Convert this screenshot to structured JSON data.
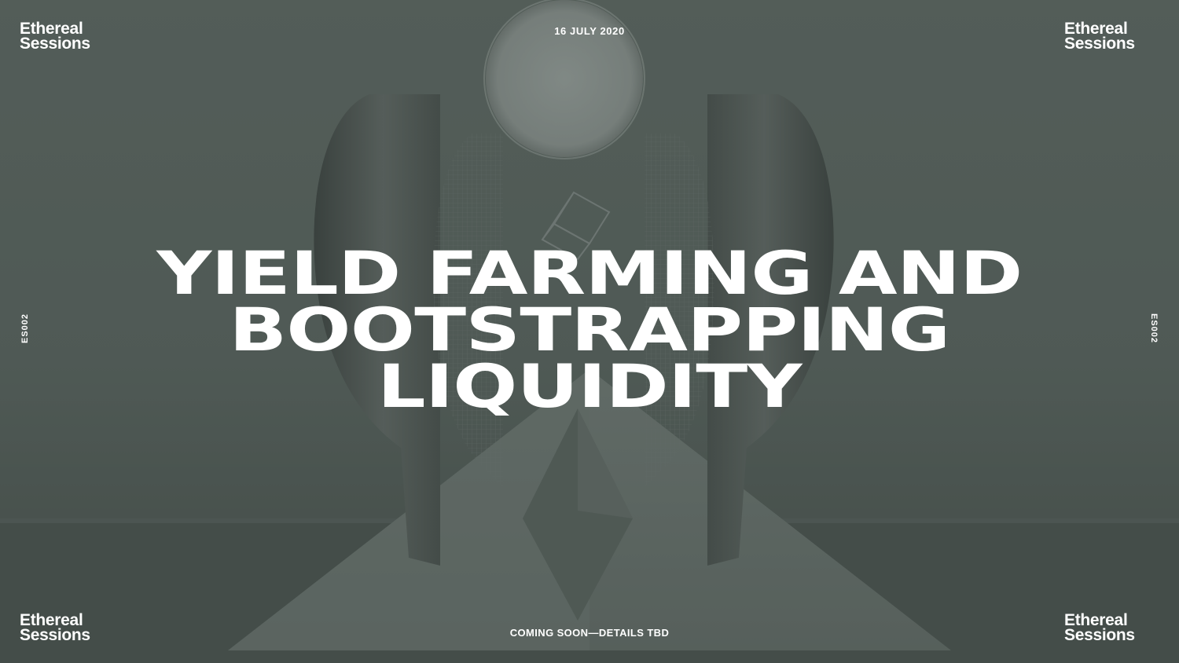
{
  "brand": {
    "line1": "Ethereal",
    "line2": "Sessions"
  },
  "event": {
    "date": "16 JULY 2020",
    "code": "ES002",
    "title_lines": [
      "YIELD FARMING AND",
      "BOOTSTRAPPING",
      "LIQUIDITY"
    ],
    "status": "COMING SOON—DETAILS TBD"
  },
  "colors": {
    "background": "#4f5a55",
    "text": "#ffffff"
  }
}
